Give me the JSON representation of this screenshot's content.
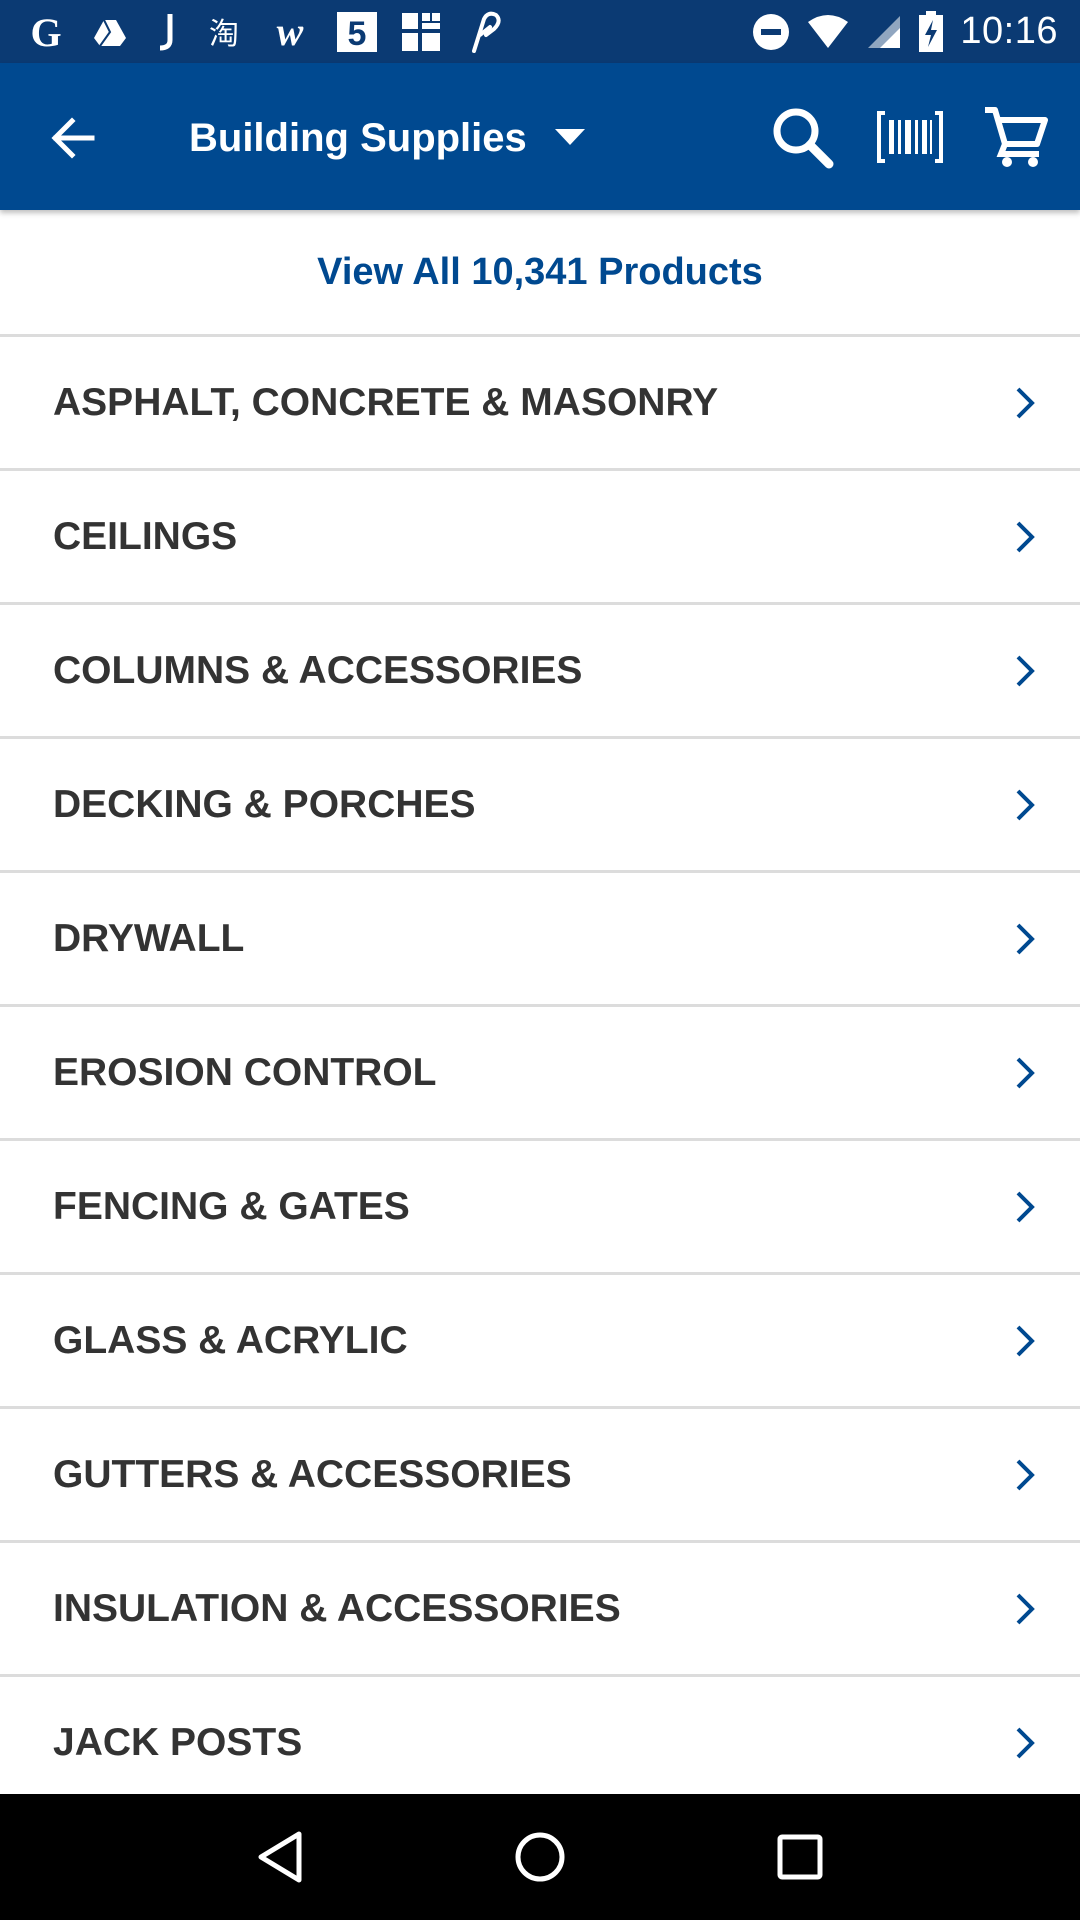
{
  "status_bar": {
    "time": "10:16",
    "left_icons": [
      "google-icon",
      "google-drive-icon",
      "j-app-icon",
      "taobao-icon",
      "w-app-icon",
      "five-app-icon",
      "grid-app-icon",
      "link-app-icon"
    ],
    "right_icons": [
      "do-not-disturb-icon",
      "wifi-icon",
      "cell-signal-icon",
      "battery-charging-icon"
    ]
  },
  "app_bar": {
    "title": "Building Supplies",
    "back_icon": "back-arrow-icon",
    "actions": [
      "search-icon",
      "barcode-scan-icon",
      "cart-icon"
    ]
  },
  "view_all": {
    "label": "View All 10,341 Products"
  },
  "categories": [
    {
      "label": "ASPHALT, CONCRETE & MASONRY"
    },
    {
      "label": "CEILINGS"
    },
    {
      "label": "COLUMNS & ACCESSORIES"
    },
    {
      "label": "DECKING & PORCHES"
    },
    {
      "label": "DRYWALL"
    },
    {
      "label": "EROSION CONTROL"
    },
    {
      "label": "FENCING & GATES"
    },
    {
      "label": "GLASS & ACRYLIC"
    },
    {
      "label": "GUTTERS & ACCESSORIES"
    },
    {
      "label": "INSULATION & ACCESSORIES"
    },
    {
      "label": "JACK POSTS"
    }
  ],
  "nav_bar": {
    "buttons": [
      "back-triangle-icon",
      "home-circle-icon",
      "recents-square-icon"
    ]
  },
  "colors": {
    "status_bar_bg": "#0b3a73",
    "app_bar_bg": "#004990",
    "accent": "#004990",
    "category_text": "#333333",
    "divider": "#dcdcdc"
  }
}
